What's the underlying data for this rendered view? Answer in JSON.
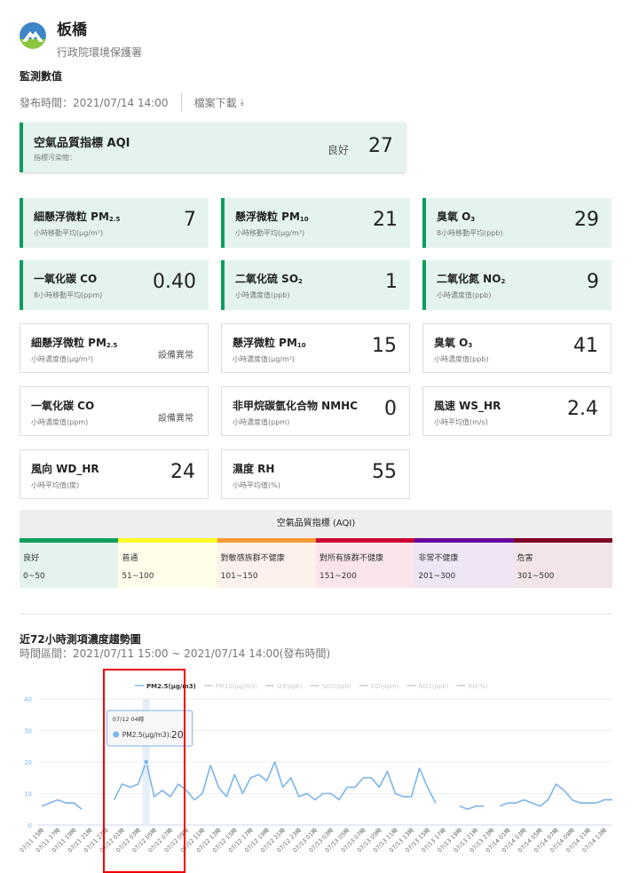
{
  "header": {
    "site": "板橋",
    "org": "行政院環境保護署",
    "section": "監測數值",
    "publish": "發布時間：2021/07/14 14:00",
    "download": "檔案下載"
  },
  "aqi_card": {
    "title": "空氣品質指標 AQI",
    "sub": "指標污染物：",
    "status": "良好",
    "value": "27"
  },
  "cards": [
    {
      "t": "細懸浮微粒 PM",
      "sub": "2.5",
      "u": "小時移動平均(μg/m³)",
      "v": "7"
    },
    {
      "t": "懸浮微粒 PM",
      "sub": "10",
      "u": "小時移動平均(μg/m³)",
      "v": "21"
    },
    {
      "t": "臭氧 O",
      "sub": "3",
      "u": "8小時移動平均(ppb)",
      "v": "29"
    },
    {
      "t": "一氧化碳 CO",
      "sub": "",
      "u": "8小時移動平均(ppm)",
      "v": "0.40"
    },
    {
      "t": "二氧化硫 SO",
      "sub": "2",
      "u": "小時濃度值(ppb)",
      "v": "1"
    },
    {
      "t": "二氧化氮 NO",
      "sub": "2",
      "u": "小時濃度值(ppb)",
      "v": "9"
    },
    {
      "t": "細懸浮微粒 PM",
      "sub": "2.5",
      "u": "小時濃度值(μg/m³)",
      "s": "設備異常"
    },
    {
      "t": "懸浮微粒 PM",
      "sub": "10",
      "u": "小時濃度值(μg/m³)",
      "v": "15"
    },
    {
      "t": "臭氧 O",
      "sub": "3",
      "u": "小時濃度值(ppb)",
      "v": "41"
    },
    {
      "t": "一氧化碳 CO",
      "sub": "",
      "u": "小時濃度值(ppm)",
      "s": "設備異常"
    },
    {
      "t": "非甲烷碳氫化合物 NMHC",
      "sub": "",
      "u": "小時濃度值(ppm)",
      "v": "0"
    },
    {
      "t": "風速 WS_HR",
      "sub": "",
      "u": "小時平均值(m/s)",
      "v": "2.4"
    },
    {
      "t": "風向 WD_HR",
      "sub": "",
      "u": "小時平均值(度)",
      "v": "24"
    },
    {
      "t": "濕度 RH",
      "sub": "",
      "u": "小時平均值(%)",
      "v": "55"
    }
  ],
  "aqi_table": {
    "title": "空氣品質指標 (AQI)",
    "levels": [
      {
        "name": "良好",
        "range": "0~50",
        "color": "#079e5d",
        "bg": "#e5f3ee"
      },
      {
        "name": "普通",
        "range": "51~100",
        "color": "#fefc26",
        "bg": "#fffeeb"
      },
      {
        "name": "對敏感族群不健康",
        "range": "101~150",
        "color": "#ff9934",
        "bg": "#fdf2eb"
      },
      {
        "name": "對所有族群不健康",
        "range": "151~200",
        "color": "#ca0034",
        "bg": "#fae5ea"
      },
      {
        "name": "非常不健康",
        "range": "201~300",
        "color": "#670099",
        "bg": "#efe5f4"
      },
      {
        "name": "危害",
        "range": "301~500",
        "color": "#7e0123",
        "bg": "#f1e5e8"
      }
    ]
  },
  "chart_section": {
    "title": "近72小時測項濃度趨勢圖",
    "range": "時間區間：2021/07/11 15:00 ~ 2021/07/14 14:00(發布時間)"
  },
  "chart_data": {
    "type": "line",
    "legend": [
      "PM2.5(μg/m3)",
      "PM10(μg/m3)",
      "O3(ppb)",
      "SO2(ppb)",
      "CO(ppm)",
      "NO2(ppb)",
      "RH(%)"
    ],
    "active_series": "PM2.5(μg/m3)",
    "ylim": [
      0,
      40
    ],
    "yticks": [
      0,
      10,
      20,
      30,
      40
    ],
    "start": "07/11 15時",
    "xlabels": [
      "07/11 15時",
      "07/11 17時",
      "07/11 19時",
      "07/11 21時",
      "07/11 23時",
      "07/12 01時",
      "07/12 03時",
      "07/12 05時",
      "07/12 07時",
      "07/12 09時",
      "07/12 11時",
      "07/12 13時",
      "07/12 15時",
      "07/12 17時",
      "07/12 19時",
      "07/12 21時",
      "07/12 23時",
      "07/13 01時",
      "07/13 03時",
      "07/13 05時",
      "07/13 07時",
      "07/13 09時",
      "07/13 11時",
      "07/13 13時",
      "07/13 15時",
      "07/13 17時",
      "07/13 19時",
      "07/13 21時",
      "07/13 23時",
      "07/14 01時",
      "07/14 03時",
      "07/14 05時",
      "07/14 07時",
      "07/14 09時",
      "07/14 11時",
      "07/14 13時"
    ],
    "values": [
      6,
      7,
      8,
      7,
      7,
      5,
      null,
      null,
      null,
      8,
      13,
      12,
      13,
      20,
      9,
      11,
      9,
      13,
      11,
      8,
      10,
      19,
      12,
      9,
      16,
      10,
      15,
      16,
      14,
      20,
      12,
      15,
      9,
      10,
      8,
      10,
      10,
      8,
      12,
      12,
      15,
      15,
      12,
      17,
      10,
      9,
      9,
      18,
      12,
      7,
      null,
      null,
      6,
      5,
      6,
      6,
      null,
      6,
      7,
      7,
      8,
      7,
      6,
      8,
      13,
      11,
      8,
      7,
      7,
      7,
      8,
      8
    ],
    "tooltip": {
      "time": "07/12 04時",
      "label": "PM2.5(μg/m3):",
      "value": "20",
      "index": 13
    },
    "color": "#7cb5ec"
  }
}
